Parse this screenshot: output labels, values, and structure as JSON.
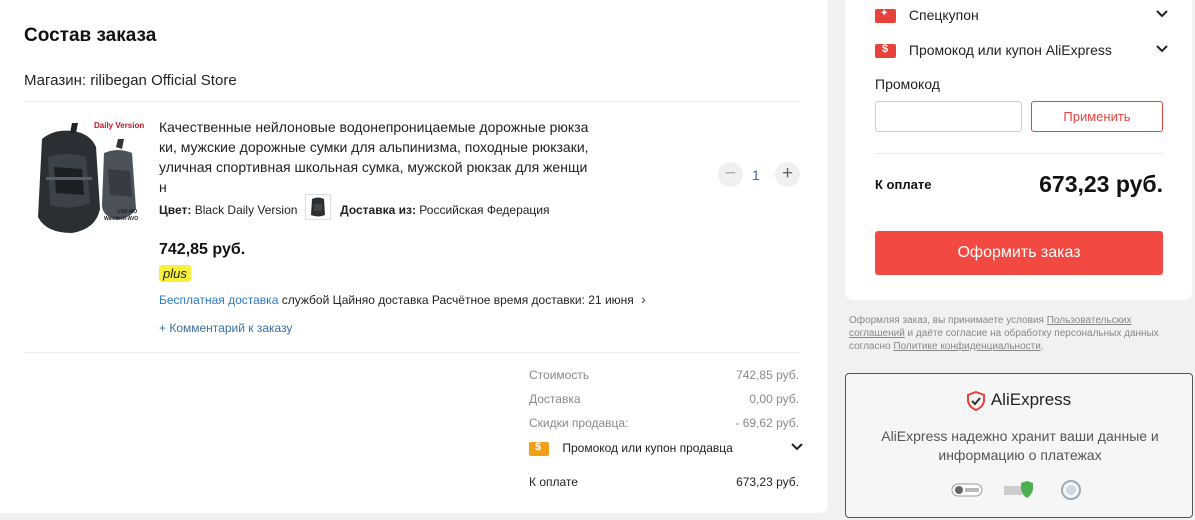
{
  "order": {
    "title": "Состав заказа",
    "store": "Магазин: rilibegan Official Store",
    "product": {
      "title": "Качественные нейлоновые водонепроницаемые дорожные рюкзаки, мужские дорожные сумки для альпинизма, походные рюкзаки, уличная спортивная школьная сумка, мужской рюкзак для женщин",
      "title_lines": [
        "Качественные нейлоновые водонепроницаемые дорожные рюкза",
        "ки, мужские дорожные сумки для альпинизма, походные рюкзаки,",
        "уличная спортивная школьная сумка, мужской рюкзак для женщи",
        "н"
      ],
      "image_badge_top": "Daily Version",
      "image_badge_bottom_1": "USB-MO",
      "image_badge_bottom_2": "Waistbelt-AVO",
      "quantity": "1",
      "qty_minus": "−",
      "qty_plus": "+",
      "color_label": "Цвет:",
      "color_value": "Black Daily Version",
      "ship_from_label": "Доставка из:",
      "ship_from_value": "Российская Федерация",
      "price": "742,85 руб.",
      "plus_badge": "plus",
      "shipping_free": "Бесплатная доставка",
      "shipping_service": "службой Цайняо доставка",
      "shipping_eta": "Расчётное время доставки: 21 июня",
      "comment_link": "+ Комментарий к заказу"
    },
    "summary": {
      "cost_label": "Стоимость",
      "cost_value": "742,85 руб.",
      "delivery_label": "Доставка",
      "delivery_value": "0,00 руб.",
      "discount_label": "Скидки продавца:",
      "discount_value": "- 69,62 руб.",
      "seller_coupon_label": "Промокод или купон продавца",
      "total_label": "К оплате",
      "total_value": "673,23 руб."
    }
  },
  "payment": {
    "special_coupon": "Спецкупон",
    "ae_coupon": "Промокод или купон AliExpress",
    "promo_label": "Промокод",
    "promo_placeholder": "",
    "apply_button": "Применить",
    "total_label": "К оплате",
    "total_value": "673,23 руб.",
    "order_button": "Оформить заказ"
  },
  "terms": {
    "part1": "Оформляя заказ, вы принимаете условия ",
    "link1": "Пользовательских соглашений",
    "part2": " и даёте согласие на обработку персональных данных согласно ",
    "link2": "Политике конфиденциальности",
    "part3": "."
  },
  "secure": {
    "brand": "AliExpress",
    "text": "AliExpress надежно хранит ваши данные и информацию о платежах"
  },
  "icons": {
    "minus": "minus-icon",
    "plus": "plus-icon",
    "chevron": "chevron-down-icon",
    "chevron_right": "chevron-right-icon",
    "shield": "shield-check-icon",
    "coupon": "coupon-icon"
  },
  "colors": {
    "accent": "#f24a43",
    "link": "#2f78c4",
    "coupon_orange": "#f39d18",
    "plus_yellow": "#f6f03a"
  }
}
